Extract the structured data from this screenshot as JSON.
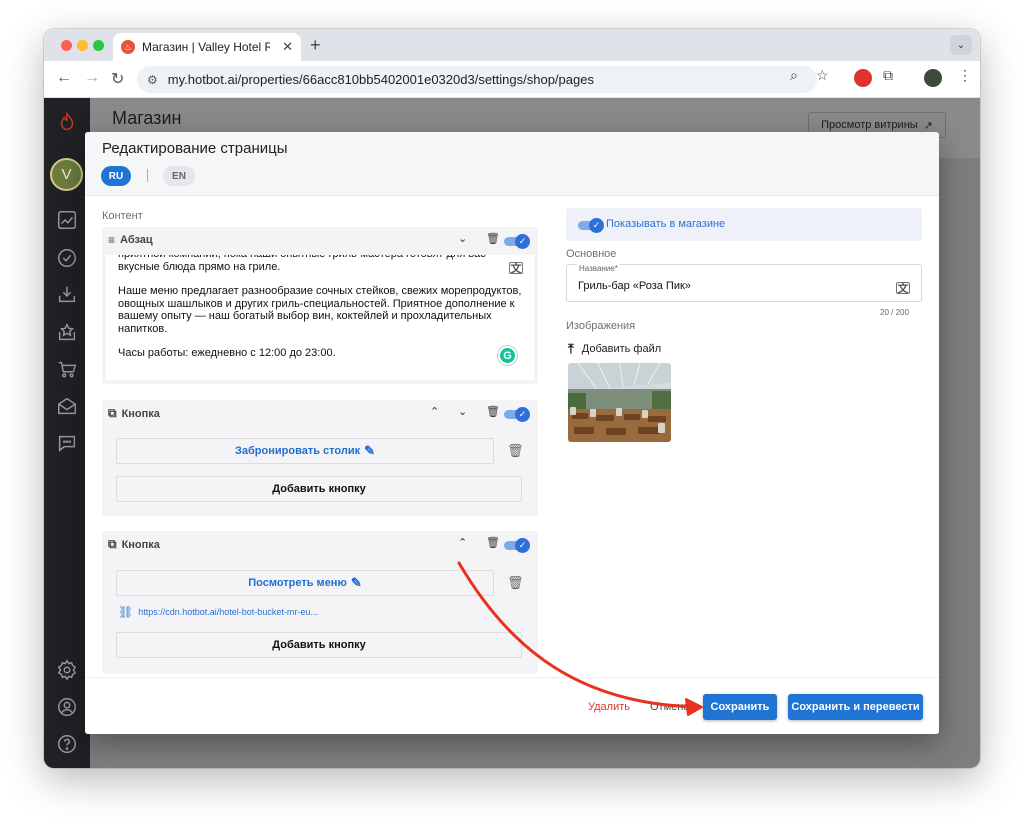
{
  "browser": {
    "tab_title": "Магазин | Valley Hotel Rosa K",
    "url": "my.hotbot.ai/properties/66acc810bb5402001e0320d3/settings/shop/pages"
  },
  "app": {
    "page_title": "Магазин",
    "preview_button": "Просмотр витрины"
  },
  "modal": {
    "title": "Редактирование страницы",
    "languages": [
      "RU",
      "EN"
    ],
    "content_label": "Контент",
    "blocks": {
      "paragraph": {
        "label": "Абзац",
        "lines_1": "приятной компании, пока наши опытные гриль-мастера готовят для вас вкусные блюда прямо на гриле.",
        "lines_2": "Наше меню предлагает разнообразие сочных стейков, свежих морепродуктов, овощных шашлыков и других гриль-специальностей. Приятное дополнение к вашему опыту — наш богатый выбор вин, коктейлей и прохладительных напитков.",
        "lines_3": "Часы работы: ежедневно с 12:00 до 23:00."
      },
      "button1": {
        "label": "Кнопка",
        "link_button": "Забронировать столик",
        "add_button": "Добавить кнопку"
      },
      "button2": {
        "label": "Кнопка",
        "link_button": "Посмотреть меню",
        "link_url": "https://cdn.hotbot.ai/hotel-bot-bucket-mr-eu...",
        "add_button": "Добавить кнопку"
      }
    },
    "right": {
      "show_in_shop": "Показывать в магазине",
      "basic_label": "Основное",
      "name_label": "Название*",
      "name_value": "Гриль-бар «Роза Пик»",
      "counter": "20 / 200",
      "images_label": "Изображения",
      "add_file": "Добавить файл"
    },
    "footer": {
      "delete": "Удалить",
      "cancel": "Отмена",
      "save": "Сохранить",
      "save_translate": "Сохранить и перевести"
    }
  },
  "colors": {
    "primary": "#1f74d4",
    "danger": "#d33a2b",
    "annotation_arrow": "#e8321f"
  }
}
